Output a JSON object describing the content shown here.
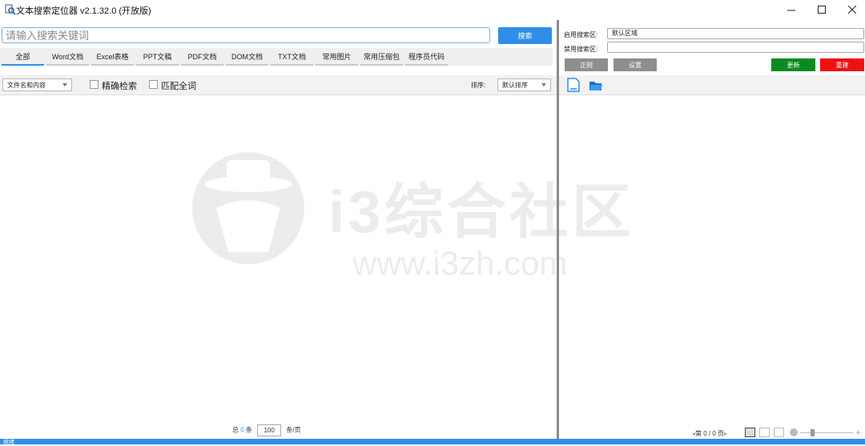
{
  "window": {
    "title": "文本搜索定位器 v2.1.32.0 (开放版)",
    "controls": [
      "minimize",
      "maximize",
      "close"
    ]
  },
  "search": {
    "placeholder": "请输入搜索关键词",
    "value": "",
    "button_label": "搜索"
  },
  "tabs": [
    {
      "label": "全部",
      "active": true
    },
    {
      "label": "Word文档",
      "active": false
    },
    {
      "label": "Excel表格",
      "active": false
    },
    {
      "label": "PPT文稿",
      "active": false
    },
    {
      "label": "PDF文档",
      "active": false
    },
    {
      "label": "DOM文档",
      "active": false
    },
    {
      "label": "TXT文档",
      "active": false
    },
    {
      "label": "常用图片",
      "active": false
    },
    {
      "label": "常用压缩包",
      "active": false
    },
    {
      "label": "程序员代码",
      "active": false
    }
  ],
  "filters": {
    "scope_select": "文件名和内容",
    "exact_label": "精确检索",
    "whole_word_label": "匹配全词",
    "sort_label": "排序:",
    "sort_select": "默认排序"
  },
  "right_panel": {
    "enabled_area_label": "启用搜索区:",
    "enabled_area_value": "默认区域",
    "disabled_area_label": "禁用搜索区:",
    "disabled_area_value": "",
    "regex_button": "正则",
    "settings_button": "设置",
    "update_button": "更新",
    "rebuild_button": "重建",
    "icons": [
      "document-icon",
      "open-folder-icon"
    ]
  },
  "watermark": {
    "text": "i3综合社区",
    "url": "www.i3zh.com"
  },
  "pager": {
    "total_prefix": "总",
    "total_count": "0",
    "total_suffix": "条",
    "page_size": "100",
    "page_size_suffix": "条/页"
  },
  "preview_pager": {
    "page_text": "第 0 / 0 页"
  },
  "status": {
    "text": "就绪"
  },
  "colors": {
    "accent": "#2f8fe8",
    "update": "#0a8a1f",
    "rebuild": "#ee1111",
    "gray_button": "#8e8e8e"
  }
}
